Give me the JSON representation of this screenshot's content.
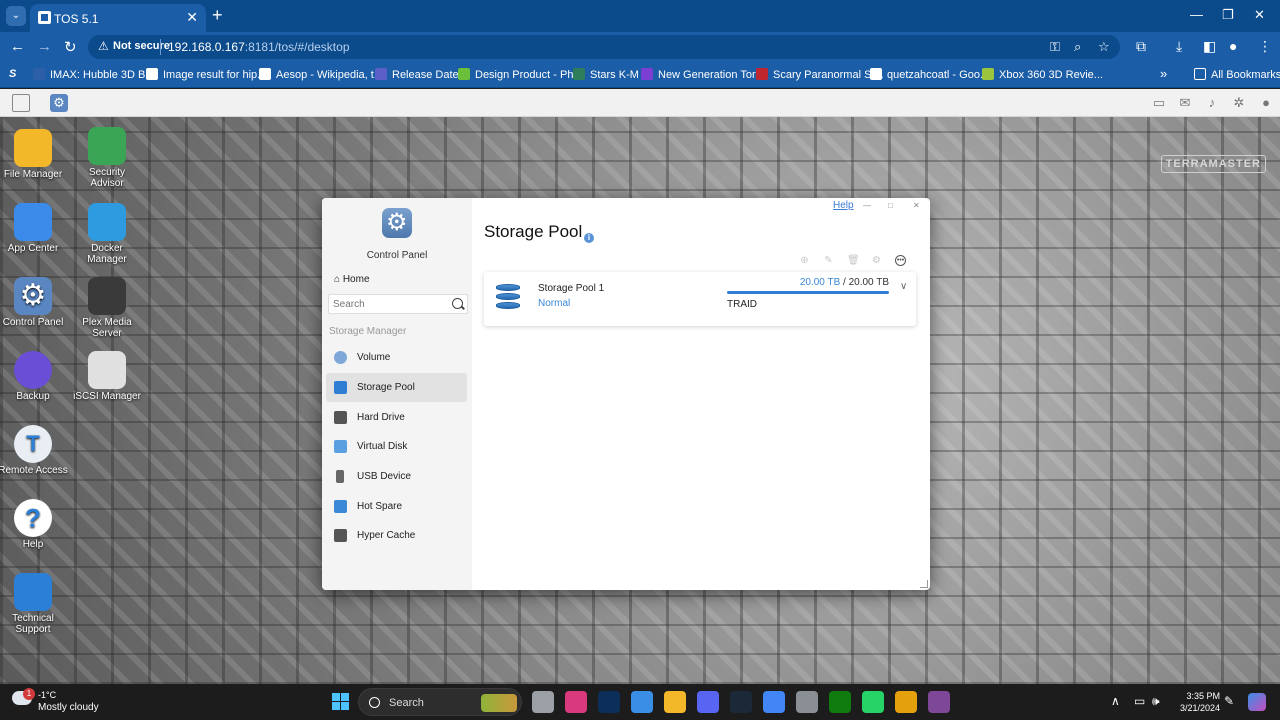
{
  "browser": {
    "tab_title": "TOS 5.1",
    "tab_close": "✕",
    "new_tab": "+",
    "security_label": "Not secure",
    "url_host": "192.168.0.167",
    "url_path": ":8181/tos/#/desktop",
    "bookmarks": [
      {
        "label": "IMAX: Hubble 3D Bl...",
        "color": "#2d5fa8"
      },
      {
        "label": "Image result for hip...",
        "color": "#ffffff"
      },
      {
        "label": "Aesop - Wikipedia, t...",
        "color": "#ffffff"
      },
      {
        "label": "Release Dates",
        "color": "#5b5fc7"
      },
      {
        "label": "Design Product - Ph...",
        "color": "#6bbf3a"
      },
      {
        "label": "Stars K-M",
        "color": "#2e7d5b"
      },
      {
        "label": "New Generation Tor...",
        "color": "#7b3fd4"
      },
      {
        "label": "Scary Paranormal St...",
        "color": "#c0262d"
      },
      {
        "label": "quetzahcoatl - Goo...",
        "color": "#ffffff"
      },
      {
        "label": "Xbox 360 3D Revie...",
        "color": "#9bc53d"
      }
    ],
    "all_bookmarks": "All Bookmarks",
    "overflow": "»"
  },
  "desktop": {
    "brand": "TERRAMASTER",
    "icons": [
      {
        "label": "File Manager",
        "name": "file-manager-icon",
        "color": "#f3b72a"
      },
      {
        "label": "Security Advisor",
        "name": "security-advisor-icon",
        "color": "#3aa655"
      },
      {
        "label": "App Center",
        "name": "app-center-icon",
        "color": "#3b8bea"
      },
      {
        "label": "Docker Manager",
        "name": "docker-manager-icon",
        "color": "#2e9be0"
      },
      {
        "label": "Control Panel",
        "name": "control-panel-icon",
        "color": "#5a86c2"
      },
      {
        "label": "Plex Media Server",
        "name": "plex-media-server-icon",
        "color": "#3a3a3a"
      },
      {
        "label": "Backup",
        "name": "backup-icon",
        "color": "#6a4fd6"
      },
      {
        "label": "iSCSI Manager",
        "name": "iscsi-manager-icon",
        "color": "#e0e0e0"
      },
      {
        "label": "Remote Access",
        "name": "remote-access-icon",
        "color": "#e9eef5"
      },
      {
        "label": "Help",
        "name": "help-icon",
        "color": "#ffffff"
      },
      {
        "label": "Technical Support",
        "name": "technical-support-icon",
        "color": "#2b7fd6"
      }
    ]
  },
  "control_panel": {
    "title": "Control Panel",
    "home": "Home",
    "search_placeholder": "Search",
    "section": "Storage Manager",
    "nav": [
      {
        "label": "Volume",
        "name": "nav-volume",
        "active": false,
        "color": "#7fa8d8"
      },
      {
        "label": "Storage Pool",
        "name": "nav-storage-pool",
        "active": true,
        "color": "#2f7ed4"
      },
      {
        "label": "Hard Drive",
        "name": "nav-hard-drive",
        "active": false,
        "color": "#555555"
      },
      {
        "label": "Virtual Disk",
        "name": "nav-virtual-disk",
        "active": false,
        "color": "#5aa0e0"
      },
      {
        "label": "USB Device",
        "name": "nav-usb-device",
        "active": false,
        "color": "#666666"
      },
      {
        "label": "Hot Spare",
        "name": "nav-hot-spare",
        "active": false,
        "color": "#3a88d6"
      },
      {
        "label": "Hyper Cache",
        "name": "nav-hyper-cache",
        "active": false,
        "color": "#555555"
      }
    ],
    "help_link": "Help",
    "page_title": "Storage Pool",
    "info_glyph": "i",
    "pool": {
      "name": "Storage Pool 1",
      "status": "Normal",
      "used": "20.00 TB",
      "separator": "/",
      "total": "20.00 TB",
      "raid": "TRAID",
      "usage_fraction": 1.0
    }
  },
  "taskbar": {
    "weather_badge": "1",
    "temperature": "-1°C",
    "condition": "Mostly cloudy",
    "search_label": "Search",
    "time": "3:35 PM",
    "date": "3/21/2024",
    "apps": [
      {
        "name": "task-view-icon",
        "color": "#9aa0a6"
      },
      {
        "name": "affinity-icon",
        "color": "#d83a7d"
      },
      {
        "name": "photoshop-icon",
        "color": "#0c2f5a"
      },
      {
        "name": "microsoft-store-icon",
        "color": "#3a8ee6"
      },
      {
        "name": "file-explorer-icon",
        "color": "#f3b72a"
      },
      {
        "name": "discord-icon",
        "color": "#5865f2"
      },
      {
        "name": "steam-icon",
        "color": "#1b2838"
      },
      {
        "name": "chrome-icon",
        "color": "#4285f4"
      },
      {
        "name": "camera-icon",
        "color": "#8a8f96"
      },
      {
        "name": "xbox-icon",
        "color": "#107c10"
      },
      {
        "name": "whatsapp-icon",
        "color": "#25d366"
      },
      {
        "name": "plex-icon",
        "color": "#e5a00d"
      },
      {
        "name": "tor-browser-icon",
        "color": "#7e4798"
      }
    ]
  }
}
